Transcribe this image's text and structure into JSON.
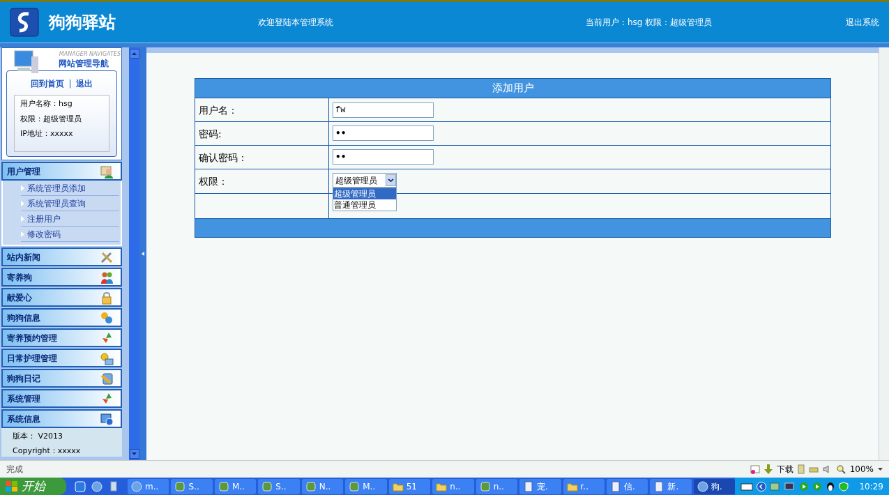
{
  "header": {
    "logo_text": "狗狗驿站",
    "welcome": "欢迎登陆本管理系统",
    "current_user": "当前用户：hsg 权限：超级管理员",
    "logout": "退出系统"
  },
  "sidebar": {
    "subtitle": "MANAGER NAVIGATES",
    "title": "网站管理导航",
    "links": [
      "回到首页",
      "退出"
    ],
    "separator": "|",
    "user_info": [
      "用户名称：hsg",
      "权限：超级管理员",
      "IP地址：xxxxx"
    ],
    "menus": [
      {
        "label": "用户管理",
        "children": [
          {
            "label": "系统管理员添加"
          },
          {
            "label": "系统管理员查询"
          },
          {
            "label": "注册用户"
          },
          {
            "label": "修改密码"
          }
        ]
      },
      {
        "label": "站内新闻"
      },
      {
        "label": "寄养狗"
      },
      {
        "label": "献爱心"
      },
      {
        "label": "狗狗信息"
      },
      {
        "label": "寄养预约管理"
      },
      {
        "label": "日常护理管理"
      },
      {
        "label": "狗狗日记"
      },
      {
        "label": "系统管理"
      },
      {
        "label": "系统信息",
        "info": [
          "版本： V2013",
          "Copyright：xxxxx"
        ]
      }
    ]
  },
  "form": {
    "title": "添加用户",
    "rows": [
      {
        "label": "用户名：",
        "kind": "text",
        "value": "fw"
      },
      {
        "label": "密码:",
        "kind": "password",
        "value": "••"
      },
      {
        "label": "确认密码：",
        "kind": "password",
        "value": "••"
      },
      {
        "label": "权限：",
        "kind": "select",
        "value": "超级管理员",
        "options": [
          {
            "label": "超级管理员",
            "selected": true
          },
          {
            "label": "普通管理员",
            "selected": false
          }
        ]
      }
    ]
  },
  "status_bar": {
    "text": "完成",
    "download": "下载",
    "zoom": "100%"
  },
  "taskbar": {
    "start": "开始",
    "tasks": [
      {
        "label": "m..",
        "selected": false
      },
      {
        "label": "S..",
        "selected": false
      },
      {
        "label": "M..",
        "selected": false
      },
      {
        "label": "S..",
        "selected": false
      },
      {
        "label": "N..",
        "selected": false
      },
      {
        "label": "M..",
        "selected": false
      },
      {
        "label": "51",
        "selected": false
      },
      {
        "label": "n..",
        "selected": false
      },
      {
        "label": "n..",
        "selected": false
      },
      {
        "label": "宠.",
        "selected": false
      },
      {
        "label": "r..",
        "selected": false
      },
      {
        "label": "信.",
        "selected": false
      },
      {
        "label": "新.",
        "selected": false
      },
      {
        "label": "狗.",
        "selected": true
      }
    ],
    "clock": "10:29"
  }
}
